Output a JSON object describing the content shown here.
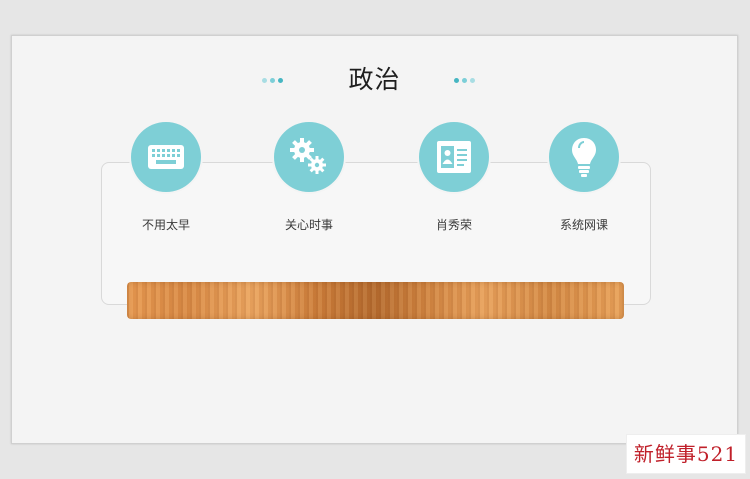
{
  "slide": {
    "title": "政治",
    "accent_color": "#7ecfd6"
  },
  "features": [
    {
      "label": "不用太早",
      "icon": "keyboard-icon"
    },
    {
      "label": "关心时事",
      "icon": "gears-icon"
    },
    {
      "label": "肖秀荣",
      "icon": "id-card-icon"
    },
    {
      "label": "系统网课",
      "icon": "lightbulb-icon"
    }
  ],
  "watermark": {
    "text": "新鲜事521"
  }
}
